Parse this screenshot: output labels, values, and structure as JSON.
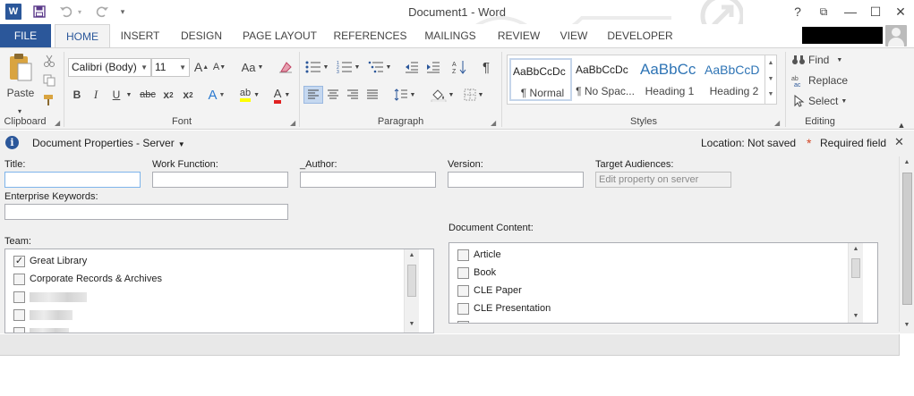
{
  "window": {
    "title": "Document1 - Word",
    "help": "?",
    "restore_ribbon": "⧉",
    "minimize": "—",
    "maximize": "☐",
    "close": "✕"
  },
  "qat": {
    "save_icon": "save-icon",
    "undo_icon": "undo-icon",
    "redo_icon": "redo-icon",
    "customize": "▾"
  },
  "tabs": [
    "FILE",
    "HOME",
    "INSERT",
    "DESIGN",
    "PAGE LAYOUT",
    "REFERENCES",
    "MAILINGS",
    "REVIEW",
    "VIEW",
    "DEVELOPER"
  ],
  "ribbon": {
    "clipboard": {
      "label": "Clipboard",
      "paste": "Paste"
    },
    "font": {
      "label": "Font",
      "font_name": "Calibri (Body)",
      "font_size": "11",
      "grow": "A",
      "shrink": "A",
      "case": "Aa",
      "bold": "B",
      "italic": "I",
      "underline": "U",
      "strike": "abc",
      "subscript": "x",
      "superscript": "x",
      "effects": "A",
      "highlight": "ab",
      "color": "A"
    },
    "paragraph": {
      "label": "Paragraph",
      "pilcrow": "¶"
    },
    "styles": {
      "label": "Styles",
      "items": [
        {
          "sample": "AaBbCcDc",
          "name": "¶ Normal"
        },
        {
          "sample": "AaBbCcDc",
          "name": "¶ No Spac..."
        },
        {
          "sample": "AaBbCc",
          "name": "Heading 1"
        },
        {
          "sample": "AaBbCcD",
          "name": "Heading 2"
        }
      ]
    },
    "editing": {
      "label": "Editing",
      "find": "Find",
      "replace": "Replace",
      "select": "Select"
    }
  },
  "docprops": {
    "title": "Document Properties - Server",
    "location": "Location: Not saved",
    "required_star": "*",
    "required": "Required field",
    "close": "✕"
  },
  "form": {
    "title_label": "Title:",
    "title_value": "",
    "work_function_label": "Work Function:",
    "author_label": "_Author:",
    "version_label": "Version:",
    "target_label": "Target Audiences:",
    "target_placeholder": "Edit property on server",
    "keywords_label": "Enterprise Keywords:",
    "team_label": "Team:",
    "team_items": [
      {
        "label": "Great Library",
        "checked": true
      },
      {
        "label": "Corporate Records & Archives",
        "checked": false
      }
    ],
    "content_label": "Document Content:",
    "content_items": [
      {
        "label": "Article",
        "checked": false
      },
      {
        "label": "Book",
        "checked": false
      },
      {
        "label": "CLE Paper",
        "checked": false
      },
      {
        "label": "CLE Presentation",
        "checked": false
      }
    ]
  },
  "colors": {
    "accent": "#2b579a",
    "ribbon_bg": "#f3f3f3",
    "panel_bg": "#f0f0f0",
    "required_star": "#d24726"
  }
}
